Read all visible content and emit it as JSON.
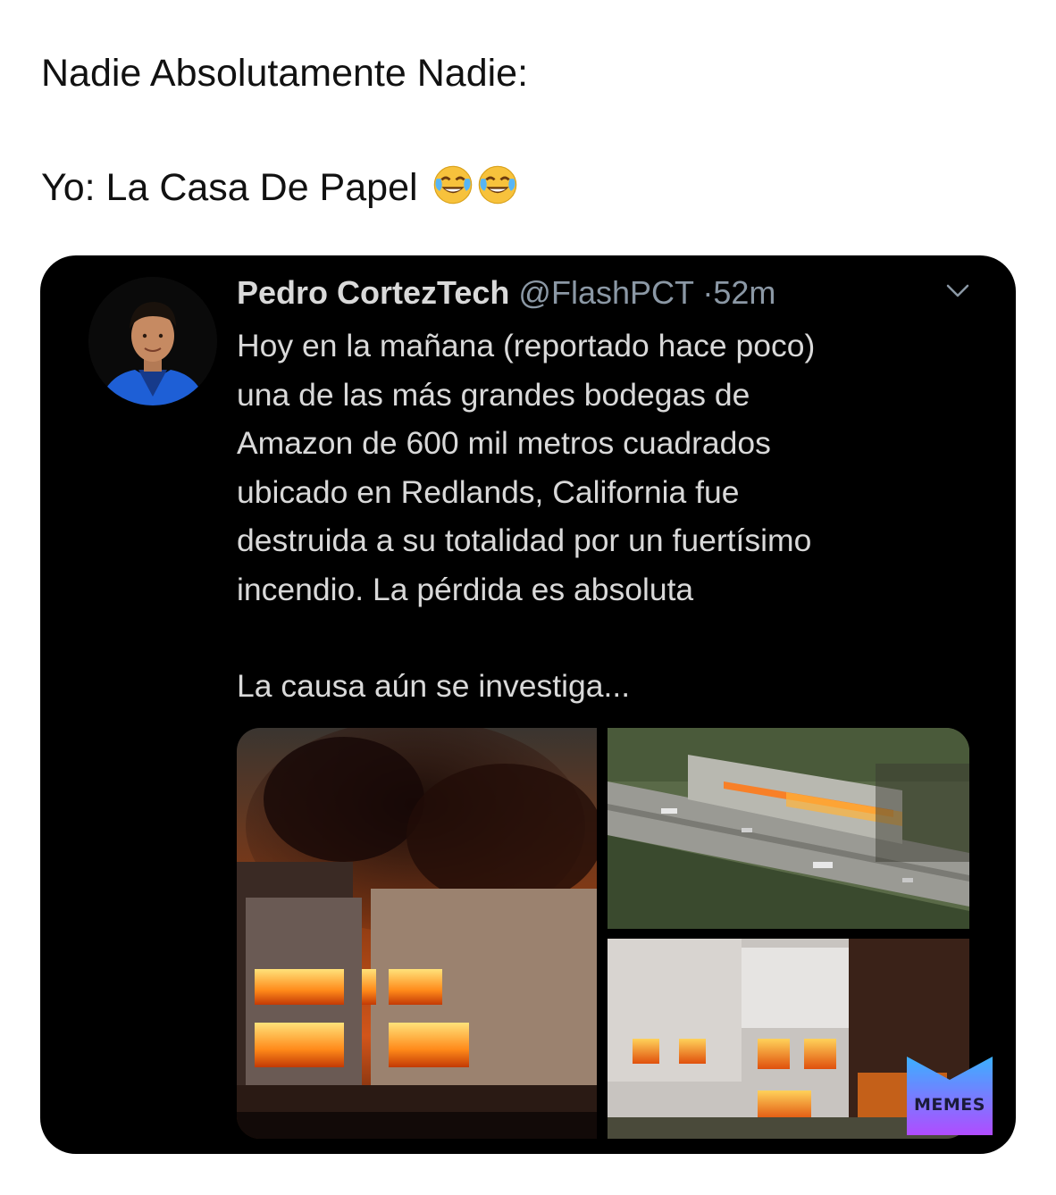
{
  "caption": {
    "line1": "Nadie Absolutamente Nadie:",
    "line2": "Yo: La Casa De Papel",
    "emoji_icon": "face-with-tears-of-joy-icon"
  },
  "tweet": {
    "author_name": "Pedro CortezTech",
    "handle": "@FlashPCT",
    "separator": "·",
    "time": "52m",
    "text_paragraph1": "Hoy en la mañana (reportado hace poco)\nuna de las más grandes bodegas de\nAmazon de 600 mil metros cuadrados\nubicado en Redlands, California fue\ndestruida a su totalidad por un fuertísimo\nincendio. La pérdida es absoluta",
    "text_paragraph2": "La causa aún se investiga...",
    "media_count": 3
  },
  "watermark": {
    "label": "MEMES"
  },
  "colors": {
    "tweet_bg": "#000000",
    "tweet_text": "#d9d9d9",
    "handle": "#8b98a5",
    "fire": "#ff8a1a",
    "badge_top": "#3bb0ff",
    "badge_bottom": "#b04cff"
  }
}
